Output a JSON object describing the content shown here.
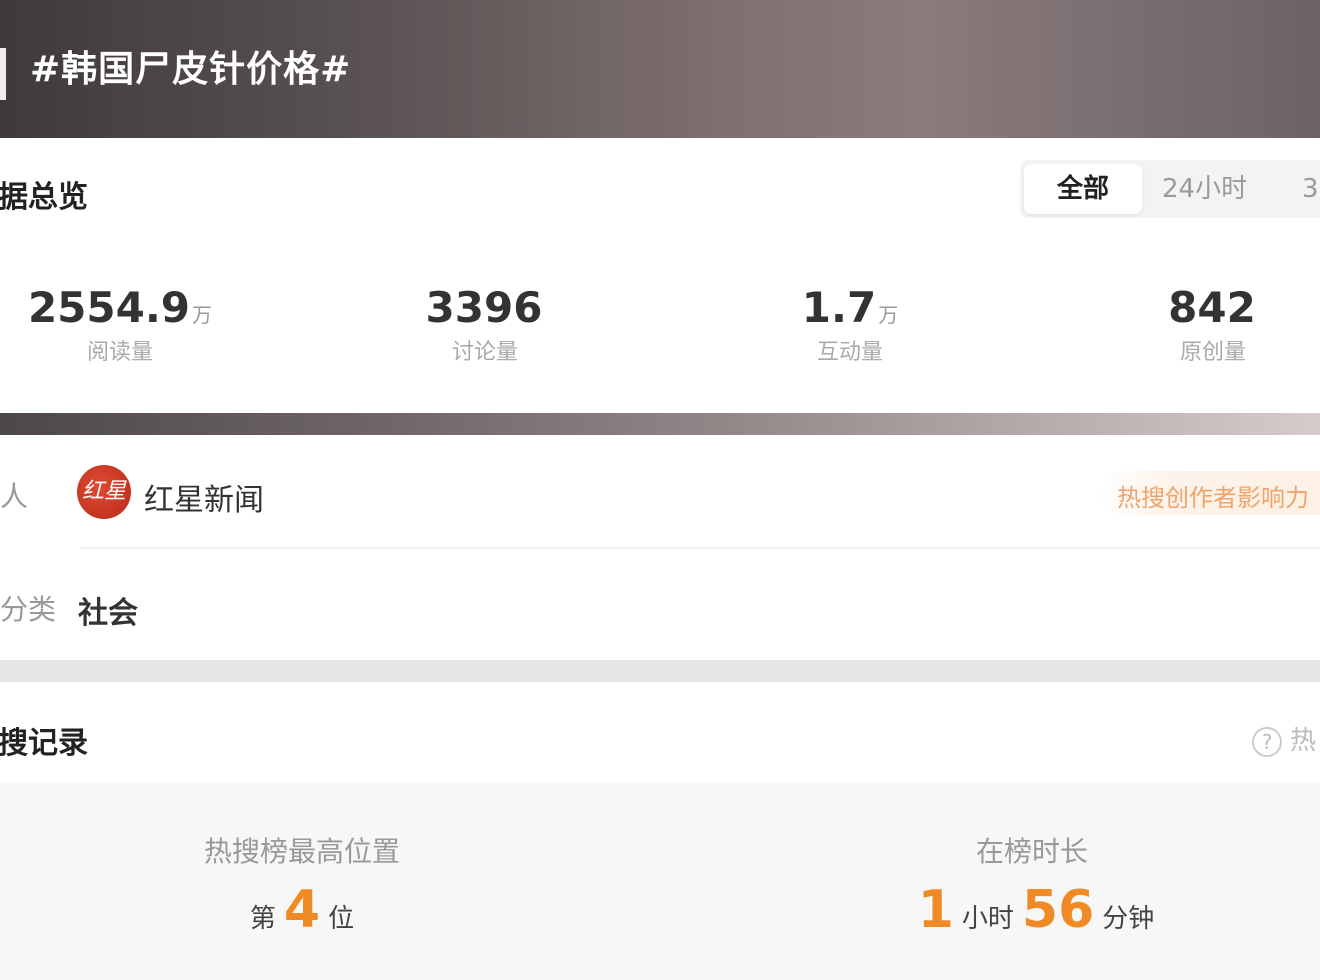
{
  "header": {
    "title": "#韩国尸皮针价格#"
  },
  "overview": {
    "title": "据总览",
    "tabs": [
      "全部",
      "24小时",
      "3"
    ],
    "active_tab": "全部",
    "stats": [
      {
        "value": "2554.9",
        "unit": "万",
        "label": "阅读量"
      },
      {
        "value": "3396",
        "unit": "",
        "label": "讨论量"
      },
      {
        "value": "1.7",
        "unit": "万",
        "label": "互动量"
      },
      {
        "value": "842",
        "unit": "",
        "label": "原创量"
      }
    ]
  },
  "info": {
    "host_label": "人",
    "host_avatar_text": "红星",
    "host_name": "红星新闻",
    "creator_badge": "热搜创作者影响力",
    "category_label": "分类",
    "category_value": "社会"
  },
  "records": {
    "title": "搜记录",
    "help_text": "热",
    "highest_position": {
      "title": "热搜榜最高位置",
      "prefix": "第",
      "value": "4",
      "suffix": "位"
    },
    "duration": {
      "title": "在榜时长",
      "hours": "1",
      "hours_unit": "小时",
      "minutes": "56",
      "minutes_unit": "分钟"
    }
  },
  "colors": {
    "accent": "#f08a24",
    "badge_text": "#f0a46a",
    "avatar": "#c8321f"
  }
}
